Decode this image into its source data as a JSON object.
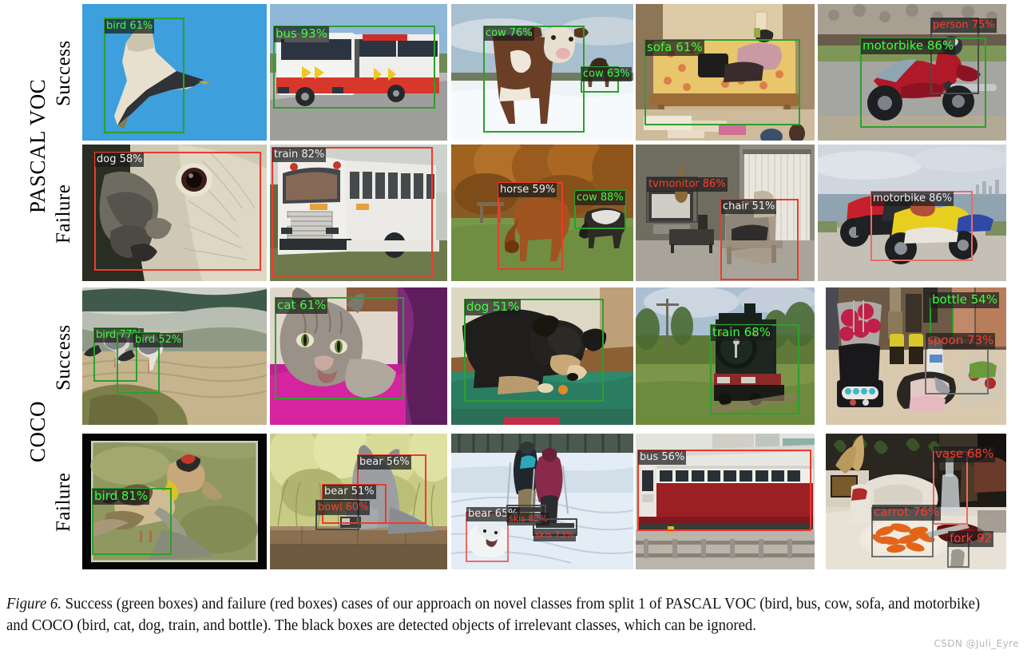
{
  "figure": {
    "caption_number": "Figure 6.",
    "caption_text": " Success (green boxes) and failure (red boxes) cases of our approach on novel classes from split 1 of PASCAL VOC (bird, bus, cow, sofa, and motorbike) and COCO (bird, cat, dog, train, and bottle). The black boxes are detected objects of irrelevant classes, which can be ignored.",
    "watermark": "CSDN @Juli_Eyre"
  },
  "axis_labels": {
    "dataset_top": "PASCAL VOC",
    "dataset_bottom": "COCO",
    "row1_state": "Success",
    "row2_state": "Failure",
    "row3_state": "Success",
    "row4_state": "Failure"
  },
  "colors": {
    "success_box": "#2ca02c",
    "failure_box": "#f0392b",
    "irrelevant_box": "#4a4a4a",
    "success_text": "#3dff3d",
    "failure_text": "#ff3b2e",
    "label_bg": "rgba(28,28,28,0.72)"
  },
  "grid": {
    "rows": [
      {
        "row_id": "pascal-success",
        "dataset": "PASCAL VOC",
        "state": "Success",
        "cells": [
          {
            "scene": "seagull-flying-blue-sky",
            "detections": [
              {
                "label": "bird 61%",
                "kind": "success"
              }
            ]
          },
          {
            "scene": "articulated-city-bus",
            "detections": [
              {
                "label": "bus 93%",
                "kind": "success"
              }
            ]
          },
          {
            "scene": "cow-in-snow-field",
            "detections": [
              {
                "label": "cow 76%",
                "kind": "success"
              },
              {
                "label": "cow 63%",
                "kind": "success"
              }
            ]
          },
          {
            "scene": "yellow-sofa-in-room",
            "detections": [
              {
                "label": "sofa 61%",
                "kind": "success"
              }
            ]
          },
          {
            "scene": "red-motorbike-rider",
            "detections": [
              {
                "label": "person 75%",
                "kind": "irrelevant"
              },
              {
                "label": "motorbike 86%",
                "kind": "success"
              }
            ]
          }
        ]
      },
      {
        "row_id": "pascal-failure",
        "dataset": "PASCAL VOC",
        "state": "Failure",
        "cells": [
          {
            "scene": "cockatoo-head-closeup",
            "detections": [
              {
                "label": "dog 58%",
                "kind": "failure"
              }
            ]
          },
          {
            "scene": "white-school-bus",
            "detections": [
              {
                "label": "train 82%",
                "kind": "failure"
              }
            ]
          },
          {
            "scene": "cows-grazing-autumn-field",
            "detections": [
              {
                "label": "horse 59%",
                "kind": "failure"
              },
              {
                "label": "cow 88%",
                "kind": "success"
              }
            ]
          },
          {
            "scene": "living-room-tv-chair",
            "detections": [
              {
                "label": "tvmonitor 86%",
                "kind": "irrelevant"
              },
              {
                "label": "chair 51%",
                "kind": "failure"
              }
            ]
          },
          {
            "scene": "two-motorbikes-by-sea",
            "detections": [
              {
                "label": "motorbike 86%",
                "kind": "failure"
              }
            ]
          }
        ]
      },
      {
        "row_id": "coco-success",
        "dataset": "COCO",
        "state": "Success",
        "cells": [
          {
            "scene": "two-gulls-on-rock",
            "detections": [
              {
                "label": "bird 77%",
                "kind": "success"
              },
              {
                "label": "bird 52%",
                "kind": "success"
              }
            ]
          },
          {
            "scene": "tabby-cat-on-pink-bed",
            "detections": [
              {
                "label": "cat 61%",
                "kind": "success"
              }
            ]
          },
          {
            "scene": "black-dog-on-green-cushion",
            "detections": [
              {
                "label": "dog 51%",
                "kind": "success"
              }
            ]
          },
          {
            "scene": "steam-locomotive",
            "detections": [
              {
                "label": "train 68%",
                "kind": "success"
              }
            ]
          },
          {
            "scene": "kitchen-blender-counter",
            "detections": [
              {
                "label": "bottle 54%",
                "kind": "success"
              },
              {
                "label": "spoon 73%",
                "kind": "irrelevant"
              }
            ]
          }
        ]
      },
      {
        "row_id": "coco-failure",
        "dataset": "COCO",
        "state": "Failure",
        "cells": [
          {
            "scene": "two-finches-on-fence",
            "detections": [
              {
                "label": "bird 81%",
                "kind": "success"
              }
            ]
          },
          {
            "scene": "grey-cat-on-deck-rail",
            "detections": [
              {
                "label": "bear 56%",
                "kind": "failure"
              },
              {
                "label": "bear 51%",
                "kind": "failure"
              },
              {
                "label": "bowl 60%",
                "kind": "irrelevant"
              }
            ]
          },
          {
            "scene": "skiers-and-white-dog-snow",
            "detections": [
              {
                "label": "bear 65%",
                "kind": "failure"
              },
              {
                "label": "skis 82%",
                "kind": "irrelevant"
              },
              {
                "label": "skis 73%",
                "kind": "irrelevant"
              }
            ]
          },
          {
            "scene": "red-railway-carriage",
            "detections": [
              {
                "label": "bus 56%",
                "kind": "failure"
              }
            ]
          },
          {
            "scene": "dinner-table-carrots",
            "detections": [
              {
                "label": "vase 68%",
                "kind": "failure"
              },
              {
                "label": "carrot 76%",
                "kind": "irrelevant"
              },
              {
                "label": "fork 92",
                "kind": "failure"
              }
            ]
          }
        ]
      }
    ]
  }
}
